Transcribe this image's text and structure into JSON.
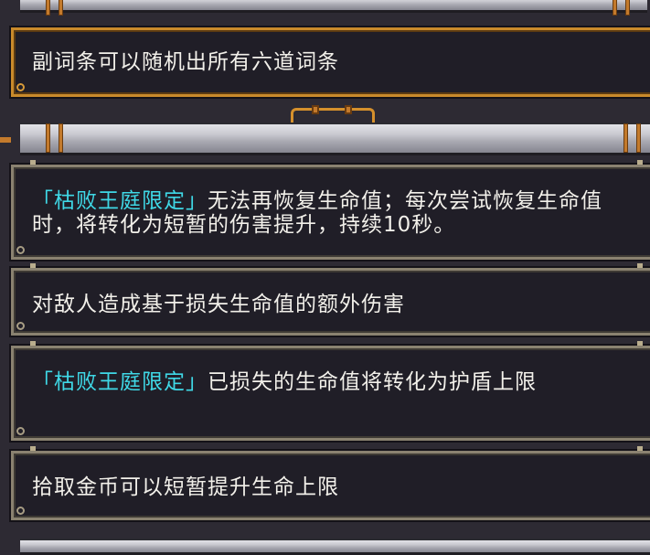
{
  "colors": {
    "background": "#2d2a33",
    "panel_fill": "#201e27",
    "panel_border": "#8a8270",
    "gold_border": "#c98a2b",
    "text": "#f2f0ea",
    "highlight": "#3fd8e6"
  },
  "header_panel": {
    "text": "副词条可以随机出所有六道词条"
  },
  "affixes": [
    {
      "tag": "「枯败王庭限定」",
      "text": "无法再恢复生命值；每次尝试恢复生命值时，将转化为短暂的伤害提升，持续10秒。"
    },
    {
      "tag": "",
      "text": "对敌人造成基于损失生命值的额外伤害"
    },
    {
      "tag": "「枯败王庭限定」",
      "text": "已损失的生命值将转化为护盾上限"
    },
    {
      "tag": "",
      "text": "拾取金币可以短暂提升生命上限"
    }
  ]
}
